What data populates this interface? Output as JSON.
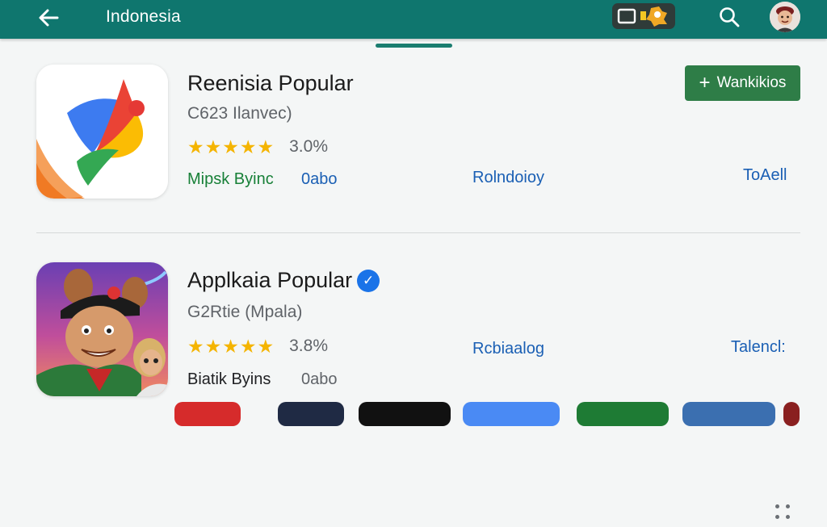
{
  "appbar": {
    "title": "Indonesia",
    "back_icon": "arrow-back-icon",
    "search_icon": "search-icon",
    "chip_icons": [
      "screen-icon",
      "puzzle-icon"
    ],
    "color": "#0f766e"
  },
  "apps": [
    {
      "title": "Reenisia Popular",
      "subtitle": "C623 Ilanvec)",
      "stars": 5,
      "rating": "3.0%",
      "meta_left": "Mipsk Byinc",
      "meta_size": "0abo",
      "meta_mid": "Rolndoioy",
      "meta_right": "ToAell",
      "action_label": "Wankikios",
      "action_icon": "plus-icon"
    },
    {
      "title": "Applkaia Popular",
      "subtitle": "G2Rtie (Mpala)",
      "stars": 5,
      "rating": "3.8%",
      "meta_left": "Biatik Byins",
      "meta_size": "0abo",
      "meta_mid": "Rcbiaalog",
      "meta_right": "Talencl:",
      "verified_icon": "verified-badge-icon",
      "more_icon": "more-vert-icon"
    }
  ],
  "colors": {
    "accent_green": "#2e7d47",
    "link_blue": "#1a5fb4",
    "star_yellow": "#f4b400"
  }
}
